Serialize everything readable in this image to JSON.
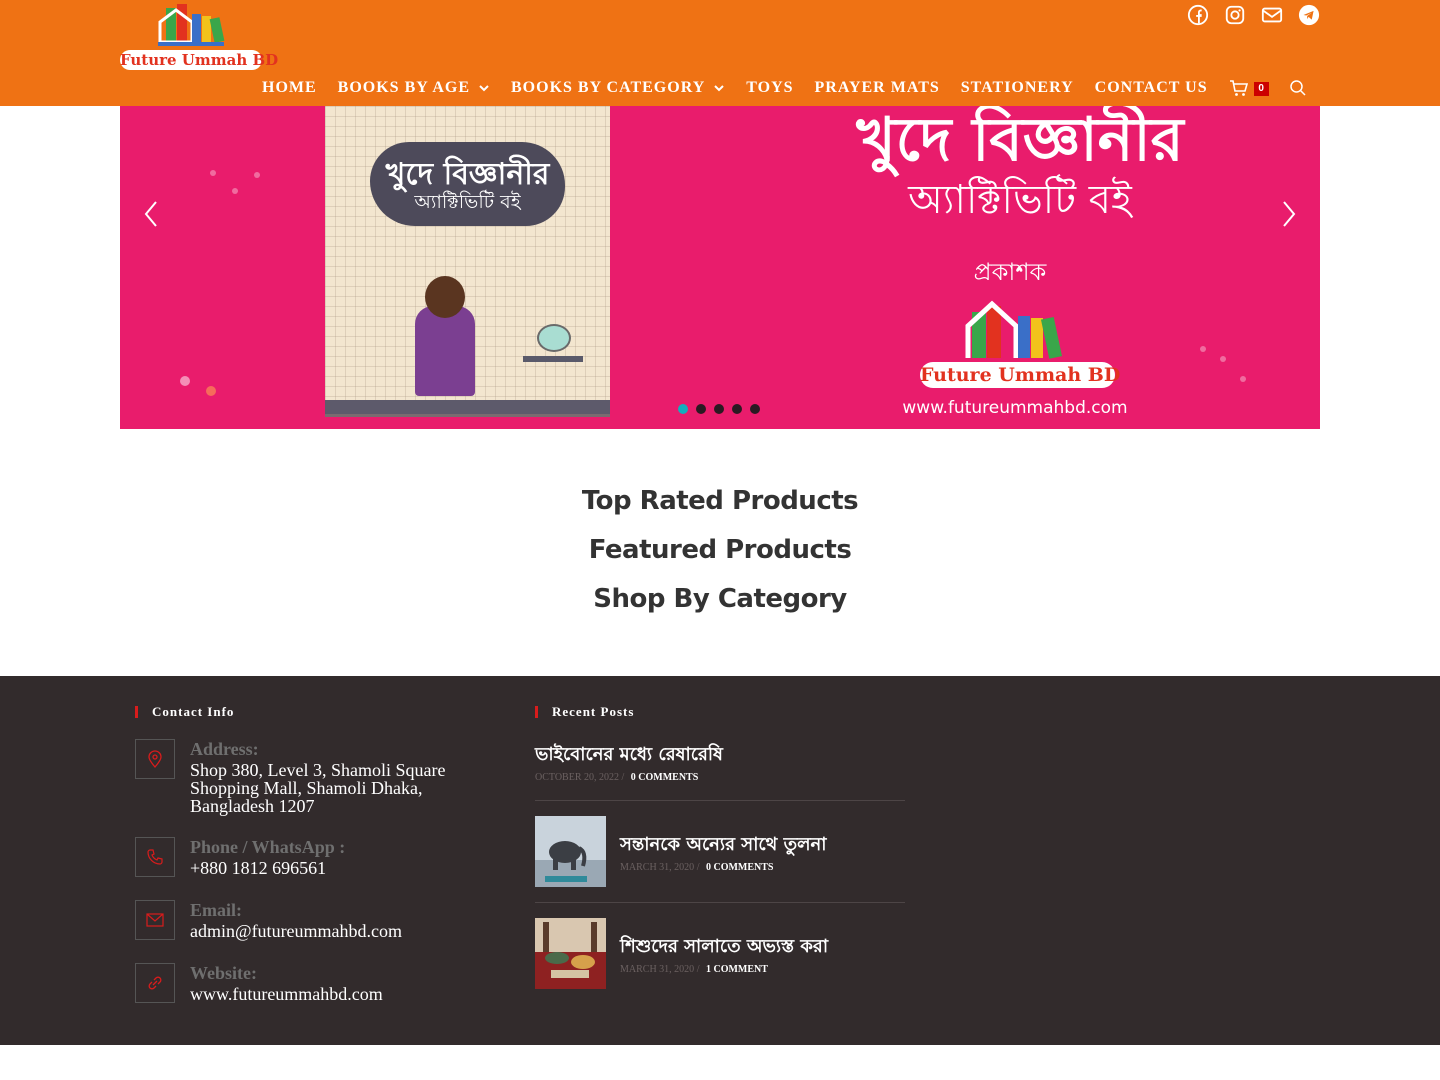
{
  "header": {
    "logo_text": "Future Ummah BD",
    "social": [
      "facebook-icon",
      "instagram-icon",
      "mail-icon",
      "telegram-icon"
    ],
    "nav": [
      {
        "label": "HOME",
        "has_dropdown": false
      },
      {
        "label": "BOOKS BY AGE",
        "has_dropdown": true
      },
      {
        "label": "BOOKS BY CATEGORY",
        "has_dropdown": true
      },
      {
        "label": "TOYS",
        "has_dropdown": false
      },
      {
        "label": "PRAYER MATS",
        "has_dropdown": false
      },
      {
        "label": "STATIONERY",
        "has_dropdown": false
      },
      {
        "label": "CONTACT US",
        "has_dropdown": false
      }
    ],
    "cart_count": "0",
    "colors": {
      "bar": "#ef7214",
      "badge": "#cc0000"
    }
  },
  "slider": {
    "book_title": "খুদে বিজ্ঞানীর",
    "book_subtitle": "অ্যাক্টিভিটি বই",
    "headline": "খুদে বিজ্ঞানীর",
    "subheadline": "অ্যাক্টিভিটি বই",
    "publisher_label": "প্রকাশক",
    "publisher_logo_text": "Future Ummah BD",
    "url": "www.futureummahbd.com",
    "slide_count": 5,
    "active_slide": 1,
    "colors": {
      "background": "#e91c6c",
      "active_dot": "#13aebd"
    }
  },
  "sections": {
    "top_rated": "Top Rated Products",
    "featured": "Featured Products",
    "shop_by_category": "Shop By Category"
  },
  "footer": {
    "contact": {
      "heading": "Contact Info",
      "address_label": "Address:",
      "address": "Shop 380, Level 3, Shamoli Square Shopping Mall, Shamoli Dhaka, Bangladesh 1207",
      "phone_label": "Phone / WhatsApp :",
      "phone": "+880 1812 696561",
      "email_label": "Email:",
      "email": "admin@futureummahbd.com",
      "website_label": "Website:",
      "website": "www.futureummahbd.com"
    },
    "recent": {
      "heading": "Recent Posts",
      "posts": [
        {
          "title": "ভাইবোনের মধ্যে রেষারেষি",
          "date": "OCTOBER 20, 2022",
          "comments": "0 COMMENTS"
        },
        {
          "title": "সন্তানকে অন্যের সাথে তুলনা",
          "date": "MARCH 31, 2020",
          "comments": "0 COMMENTS"
        },
        {
          "title": "শিশুদের সালাতে অভ্যস্ত করা",
          "date": "MARCH 31, 2020",
          "comments": "1 COMMENT"
        }
      ]
    },
    "colors": {
      "background": "#322b2c",
      "accent": "#d81c1c"
    }
  }
}
